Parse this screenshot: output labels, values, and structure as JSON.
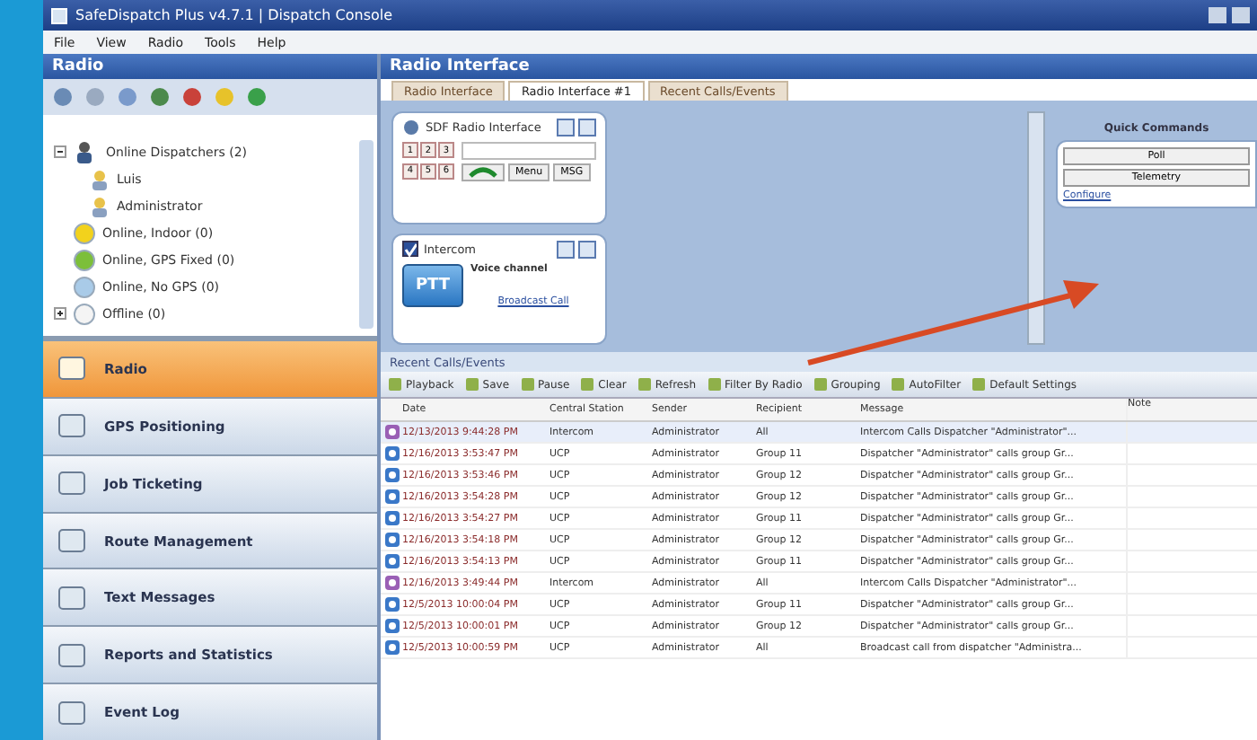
{
  "window": {
    "title": "SafeDispatch Plus v4.7.1 | Dispatch Console"
  },
  "menu": [
    "File",
    "View",
    "Radio",
    "Tools",
    "Help"
  ],
  "left_panel": {
    "title": "Radio",
    "tree": [
      {
        "label": "Online Dispatchers (2)",
        "kind": "group",
        "expanded": true,
        "children": [
          {
            "label": "Luis",
            "kind": "user"
          },
          {
            "label": "Administrator",
            "kind": "user"
          }
        ]
      },
      {
        "label": "Online, Indoor (0)",
        "kind": "status",
        "color": "#f2d21c"
      },
      {
        "label": "Online, GPS Fixed (0)",
        "kind": "status",
        "color": "#7cbf3a"
      },
      {
        "label": "Online, No GPS (0)",
        "kind": "status",
        "color": "#a9cbe8"
      },
      {
        "label": "Offline (0)",
        "kind": "status",
        "color": "#f4f4f4",
        "expanded": false
      }
    ],
    "nav": [
      {
        "label": "Radio",
        "selected": true
      },
      {
        "label": "GPS Positioning",
        "selected": false
      },
      {
        "label": "Job Ticketing",
        "selected": false
      },
      {
        "label": "Route Management",
        "selected": false
      },
      {
        "label": "Text Messages",
        "selected": false
      },
      {
        "label": "Reports and Statistics",
        "selected": false
      },
      {
        "label": "Event Log",
        "selected": false
      }
    ]
  },
  "radio_interface": {
    "title": "Radio Interface",
    "tabs": [
      {
        "label": "Radio Interface",
        "selected": false
      },
      {
        "label": "Radio Interface #1",
        "selected": true
      },
      {
        "label": "Recent Calls/Events",
        "selected": false
      }
    ],
    "radio_panel": {
      "title": "SDF Radio Interface",
      "keys": [
        "1",
        "2",
        "3",
        "4",
        "5",
        "6"
      ],
      "buttons": [
        "Menu",
        "MSG"
      ]
    },
    "intercom_panel": {
      "label": "Intercom",
      "checked": true,
      "ptt": "PTT",
      "channel": "Voice channel",
      "link": "Broadcast Call"
    },
    "quick_commands": {
      "title": "Quick Commands",
      "buttons": [
        "Poll",
        "Telemetry"
      ],
      "link": "Configure"
    }
  },
  "recent_calls": {
    "title": "Recent Calls/Events",
    "toolbar": [
      "Playback",
      "Save",
      "Pause",
      "Clear",
      "Refresh",
      "Filter By Radio",
      "Grouping",
      "AutoFilter",
      "Default Settings"
    ],
    "columns": [
      "Date",
      "Central Station",
      "Sender",
      "Recipient",
      "Message",
      "Note"
    ],
    "rows": [
      {
        "kind": "intercom",
        "cells": [
          "12/13/2013 9:44:28 PM",
          "Intercom",
          "Administrator",
          "All",
          "Intercom Calls Dispatcher \"Administrator\"..."
        ]
      },
      {
        "kind": "call",
        "cells": [
          "12/16/2013 3:53:47 PM",
          "UCP",
          "Administrator",
          "Group 11",
          "Dispatcher \"Administrator\" calls group Gr..."
        ]
      },
      {
        "kind": "call",
        "cells": [
          "12/16/2013 3:53:46 PM",
          "UCP",
          "Administrator",
          "Group 12",
          "Dispatcher \"Administrator\" calls group Gr..."
        ]
      },
      {
        "kind": "call",
        "cells": [
          "12/16/2013 3:54:28 PM",
          "UCP",
          "Administrator",
          "Group 12",
          "Dispatcher \"Administrator\" calls group Gr..."
        ]
      },
      {
        "kind": "call",
        "cells": [
          "12/16/2013 3:54:27 PM",
          "UCP",
          "Administrator",
          "Group 11",
          "Dispatcher \"Administrator\" calls group Gr..."
        ]
      },
      {
        "kind": "call",
        "cells": [
          "12/16/2013 3:54:18 PM",
          "UCP",
          "Administrator",
          "Group 12",
          "Dispatcher \"Administrator\" calls group Gr..."
        ]
      },
      {
        "kind": "call",
        "cells": [
          "12/16/2013 3:54:13 PM",
          "UCP",
          "Administrator",
          "Group 11",
          "Dispatcher \"Administrator\" calls group Gr..."
        ]
      },
      {
        "kind": "intercom",
        "cells": [
          "12/16/2013 3:49:44 PM",
          "Intercom",
          "Administrator",
          "All",
          "Intercom Calls Dispatcher \"Administrator\"..."
        ]
      },
      {
        "kind": "call",
        "cells": [
          "12/5/2013 10:00:04 PM",
          "UCP",
          "Administrator",
          "Group 11",
          "Dispatcher \"Administrator\" calls group Gr..."
        ]
      },
      {
        "kind": "call",
        "cells": [
          "12/5/2013 10:00:01 PM",
          "UCP",
          "Administrator",
          "Group 12",
          "Dispatcher \"Administrator\" calls group Gr..."
        ]
      },
      {
        "kind": "call",
        "cells": [
          "12/5/2013 10:00:59 PM",
          "UCP",
          "Administrator",
          "All",
          "Broadcast call from dispatcher \"Administra..."
        ]
      }
    ]
  }
}
